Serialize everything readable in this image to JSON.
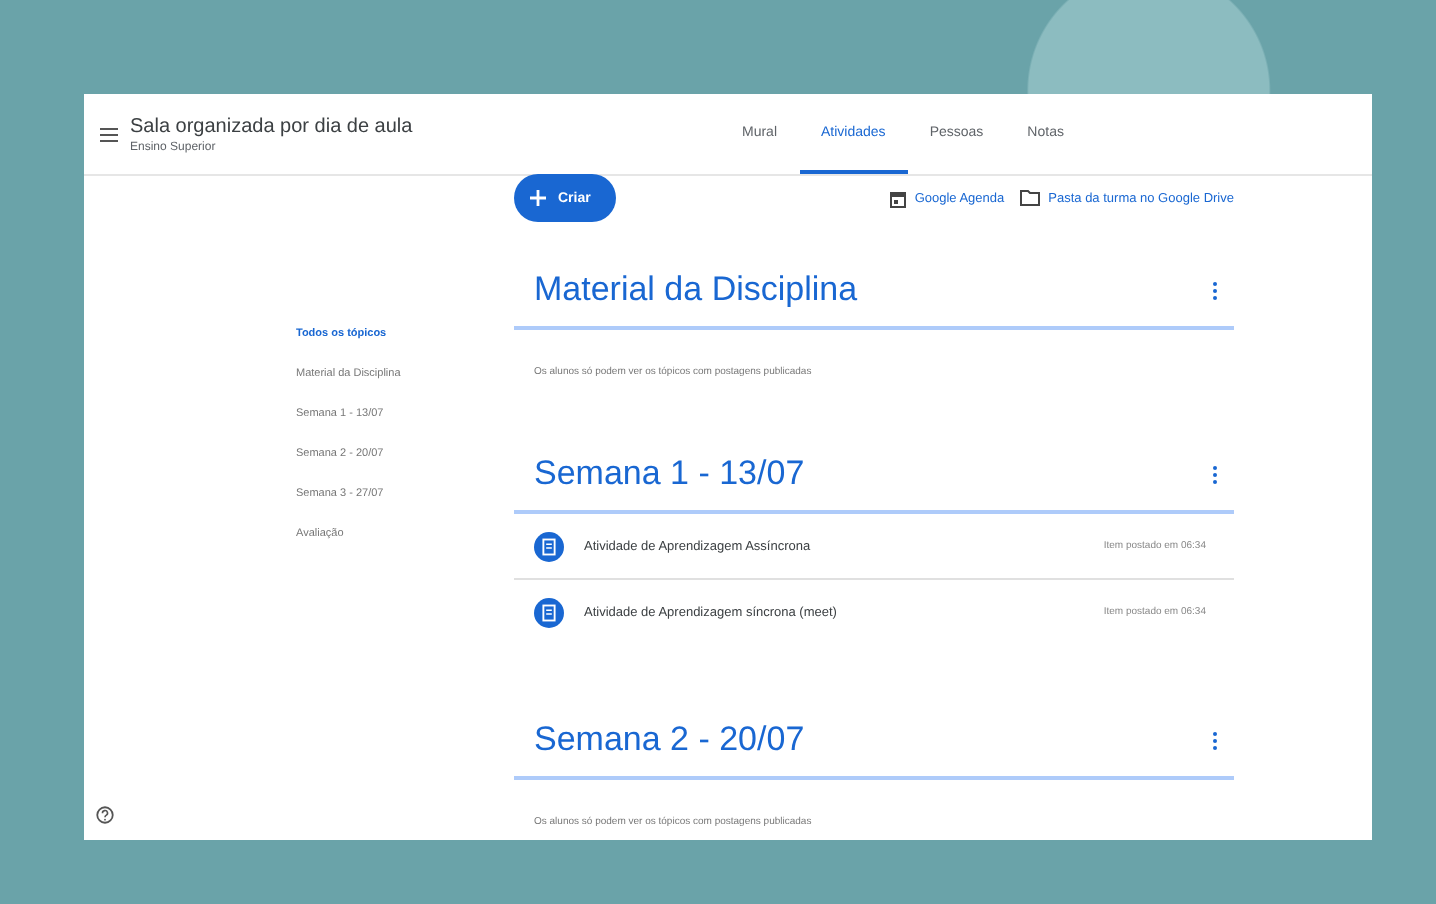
{
  "header": {
    "title": "Sala organizada por dia de aula",
    "subtitle": "Ensino Superior"
  },
  "tabs": [
    {
      "label": "Mural",
      "selected": false
    },
    {
      "label": "Atividades",
      "selected": true
    },
    {
      "label": "Pessoas",
      "selected": false
    },
    {
      "label": "Notas",
      "selected": false
    }
  ],
  "create_button": {
    "label": "Criar"
  },
  "links": [
    {
      "kind": "calendar",
      "label": "Google Agenda"
    },
    {
      "kind": "folder",
      "label": "Pasta da turma no Google Drive"
    }
  ],
  "sidebar": {
    "items": [
      {
        "label": "Todos os tópicos",
        "selected": true
      },
      {
        "label": "Material da Disciplina",
        "selected": false
      },
      {
        "label": "Semana 1 - 13/07",
        "selected": false
      },
      {
        "label": "Semana 2 - 20/07",
        "selected": false
      },
      {
        "label": "Semana 3 - 27/07",
        "selected": false
      },
      {
        "label": "Avaliação",
        "selected": false
      }
    ]
  },
  "topics": [
    {
      "title": "Material da Disciplina",
      "note": "Os alunos só podem ver os tópicos com postagens publicadas"
    },
    {
      "title": "Semana 1 - 13/07",
      "items": [
        {
          "title": "Atividade de Aprendizagem Assíncrona",
          "meta": "Item postado em 06:34"
        },
        {
          "title": "Atividade de Aprendizagem síncrona (meet)",
          "meta": "Item postado em 06:34"
        }
      ]
    },
    {
      "title": "Semana 2 - 20/07",
      "note": "Os alunos só podem ver os tópicos com postagens publicadas"
    }
  ]
}
